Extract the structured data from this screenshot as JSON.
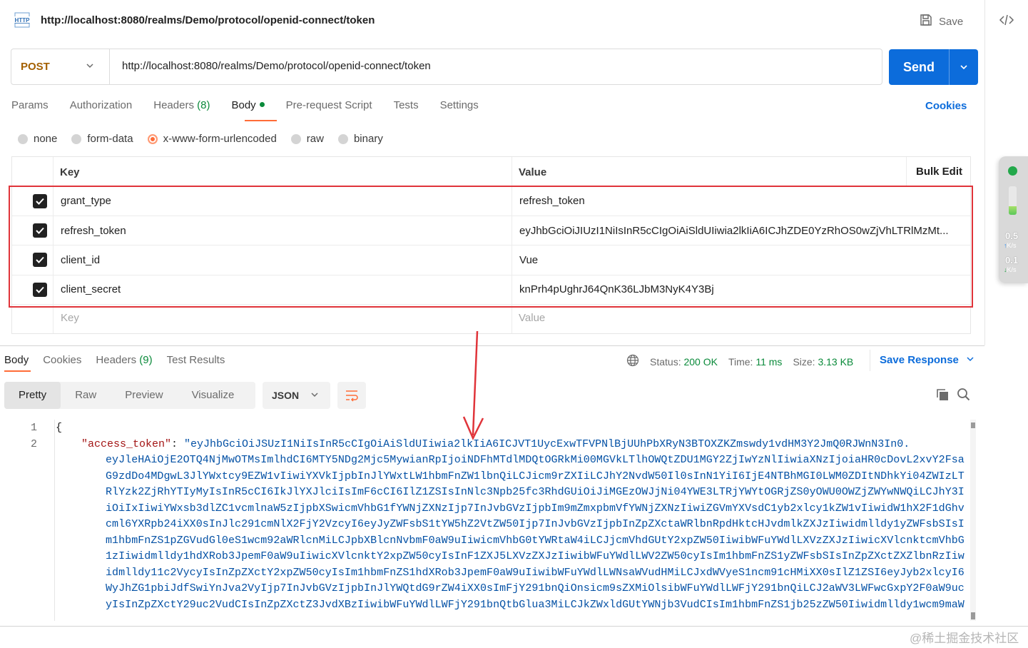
{
  "header": {
    "title_url": "http://localhost:8080/realms/Demo/protocol/openid-connect/token",
    "http_badge": "HTTP",
    "save_label": "Save"
  },
  "request": {
    "method": "POST",
    "url": "http://localhost:8080/realms/Demo/protocol/openid-connect/token",
    "send_label": "Send"
  },
  "tabs": {
    "params": "Params",
    "authorization": "Authorization",
    "headers": "Headers",
    "headers_count": "(8)",
    "body": "Body",
    "prerequest": "Pre-request Script",
    "tests": "Tests",
    "settings": "Settings",
    "cookies": "Cookies"
  },
  "body_types": {
    "none": "none",
    "form_data": "form-data",
    "urlencoded": "x-www-form-urlencoded",
    "raw": "raw",
    "binary": "binary",
    "selected": "x-www-form-urlencoded"
  },
  "table": {
    "key_header": "Key",
    "value_header": "Value",
    "bulk_edit": "Bulk Edit",
    "rows": [
      {
        "key": "grant_type",
        "value": "refresh_token",
        "checked": true
      },
      {
        "key": "refresh_token",
        "value": "eyJhbGciOiJIUzI1NiIsInR5cCIgOiAiSldUIiwia2lkIiA6ICJhZDE0YzRhOS0wZjVhLTRlMzMt...",
        "checked": true
      },
      {
        "key": "client_id",
        "value": "Vue",
        "checked": true
      },
      {
        "key": "client_secret",
        "value": "knPrh4pUghrJ64QnK36LJbM3NyK4Y3Bj",
        "checked": true
      }
    ],
    "key_placeholder": "Key",
    "value_placeholder": "Value"
  },
  "response": {
    "tabs": {
      "body": "Body",
      "cookies": "Cookies",
      "headers": "Headers",
      "headers_count": "(9)",
      "test_results": "Test Results"
    },
    "status_label": "Status:",
    "status_value": "200 OK",
    "time_label": "Time:",
    "time_value": "11 ms",
    "size_label": "Size:",
    "size_value": "3.13 KB",
    "save_response": "Save Response",
    "views": {
      "pretty": "Pretty",
      "raw": "Raw",
      "preview": "Preview",
      "visualize": "Visualize"
    },
    "format": "JSON",
    "line_numbers": [
      "1",
      "2"
    ],
    "line1": "{",
    "line2_key": "\"access_token\"",
    "line2_colon": ": ",
    "line2_value": "\"eyJhbGciOiJSUzI1NiIsInR5cCIgOiAiSldUIiwia2lkIiA6ICJVT1UycExwTFVPNlBjUUhPbXRyN3BTOXZKZmswdy1vdHM3Y2JmQ0RJWnN3In0.",
    "continuation": [
      "eyJleHAiOjE2OTQ4NjMwOTMsImlhdCI6MTY5NDg2Mjc5MywianRpIjoiNDFhMTdlMDQtOGRkMi00MGVkLTlhOWQtZDU1MGY2ZjIwYzNlIiwiaXNzIjoiaHR0cDovL2xvY2Fsa",
      "G9zdDo4MDgwL3JlYWxtcy9EZW1vIiwiYXVkIjpbInJlYWxtLW1hbmFnZW1lbnQiLCJicm9rZXIiLCJhY2NvdW50Il0sInN1YiI6IjE4NTBhMGI0LWM0ZDItNDhkYi04ZWIzLT",
      "RlYzk2ZjRhYTIyMyIsInR5cCI6IkJlYXJlciIsImF6cCI6IlZ1ZSIsInNlc3Npb25fc3RhdGUiOiJiMGEzOWJjNi04YWE3LTRjYWYtOGRjZS0yOWU0OWZjZWYwNWQiLCJhY3I",
      "iOiIxIiwiYWxsb3dlZC1vcmlnaW5zIjpbXSwicmVhbG1fYWNjZXNzIjp7InJvbGVzIjpbIm9mZmxpbmVfYWNjZXNzIiwiZGVmYXVsdC1yb2xlcy1kZW1vIiwidW1hX2F1dGhv",
      "cml6YXRpb24iXX0sInJlc291cmNlX2FjY2VzcyI6eyJyZWFsbS1tYW5hZ2VtZW50Ijp7InJvbGVzIjpbInZpZXctaWRlbnRpdHktcHJvdmlkZXJzIiwidmlldy1yZWFsbSIsI",
      "m1hbmFnZS1pZGVudGl0eS1wcm92aWRlcnMiLCJpbXBlcnNvbmF0aW9uIiwicmVhbG0tYWRtaW4iLCJjcmVhdGUtY2xpZW50IiwibWFuYWdlLXVzZXJzIiwicXVlcnktcmVhbG",
      "1zIiwidmlldy1hdXRob3JpemF0aW9uIiwicXVlcnktY2xpZW50cyIsInF1ZXJ5LXVzZXJzIiwibWFuYWdlLWV2ZW50cyIsIm1hbmFnZS1yZWFsbSIsInZpZXctZXZlbnRzIiw",
      "idmlldy11c2VycyIsInZpZXctY2xpZW50cyIsIm1hbmFnZS1hdXRob3JpemF0aW9uIiwibWFuYWdlLWNsaWVudHMiLCJxdWVyeS1ncm91cHMiXX0sIlZ1ZSI6eyJyb2xlcyI6",
      "WyJhZG1pbiJdfSwiYnJva2VyIjp7InJvbGVzIjpbInJlYWQtdG9rZW4iXX0sImFjY291bnQiOnsicm9sZXMiOlsibWFuYWdlLWFjY291bnQiLCJ2aWV3LWFwcGxpY2F0aW9uc",
      "yIsInZpZXctY29uc2VudCIsInZpZXctZ3JvdXBzIiwibWFuYWdlLWFjY291bnQtbGlua3MiLCJkZWxldGUtYWNjb3VudCIsIm1hbmFnZS1jb25zZW50Iiwidmlldy1wcm9maW"
    ]
  },
  "side_widget": {
    "up_value": "0.5",
    "up_unit": "K/s",
    "down_value": "0.1",
    "down_unit": "K/s"
  },
  "watermark": "@稀土掘金技术社区",
  "colors": {
    "accent": "#ff6c37",
    "send": "#0c6cdb",
    "success": "#0a8a3a",
    "method": "#a35f00",
    "annotation": "#e0343a"
  }
}
